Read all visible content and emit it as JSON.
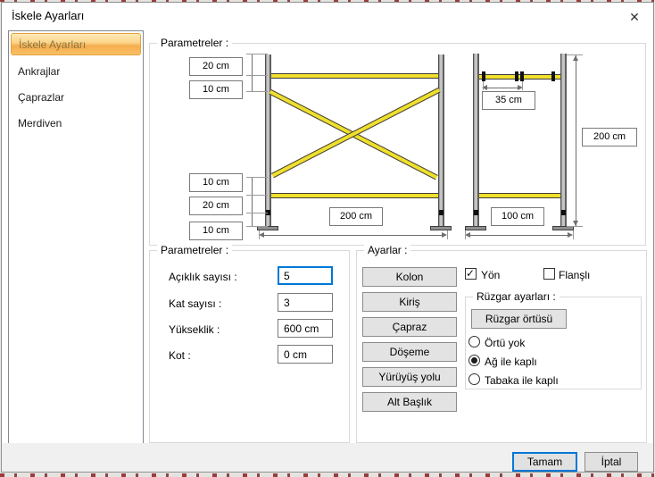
{
  "window": {
    "title": "İskele Ayarları",
    "close_glyph": "✕"
  },
  "sidebar": {
    "items": [
      {
        "label": "İskele Ayarları",
        "selected": true
      },
      {
        "label": "Ankrajlar",
        "selected": false
      },
      {
        "label": "Çaprazlar",
        "selected": false
      },
      {
        "label": "Merdiven",
        "selected": false
      }
    ]
  },
  "diagram_group": {
    "title": "Parametreler :",
    "dim_labels": {
      "top_offset": "20 cm",
      "top_gap": "10 cm",
      "rail_gap": "10 cm",
      "toe_gap": "20 cm",
      "base_gap": "10 cm",
      "bay_width": "200 cm",
      "stud_spacing": "35 cm",
      "frame_height": "200 cm",
      "frame_width": "100 cm"
    }
  },
  "params_group": {
    "title": "Parametreler :",
    "fields": [
      {
        "label": "Açıklık sayısı :",
        "value": "5"
      },
      {
        "label": "Kat sayısı :",
        "value": "3"
      },
      {
        "label": "Yükseklik :",
        "value": "600 cm"
      },
      {
        "label": "Kot :",
        "value": "0 cm"
      }
    ]
  },
  "settings_group": {
    "title": "Ayarlar :",
    "buttons": [
      "Kolon",
      "Kiriş",
      "Çapraz",
      "Döşeme",
      "Yürüyüş yolu",
      "Alt Başlık"
    ],
    "checkboxes": [
      {
        "label": "Yön",
        "checked": true
      },
      {
        "label": "Flanşlı",
        "checked": false
      }
    ],
    "wind": {
      "title": "Rüzgar ayarları :",
      "button": "Rüzgar örtüsü",
      "options": [
        {
          "label": "Örtü yok",
          "selected": false
        },
        {
          "label": "Ağ ile kaplı",
          "selected": true
        },
        {
          "label": "Tabaka ile kaplı",
          "selected": false
        }
      ]
    }
  },
  "footer": {
    "ok": "Tamam",
    "cancel": "İptal"
  },
  "colors": {
    "accent": "#0078d7",
    "selected_item_orange": "#f6ad4e",
    "rail_yellow": "#f0df2c",
    "footer_bg": "#f0f0f0"
  }
}
